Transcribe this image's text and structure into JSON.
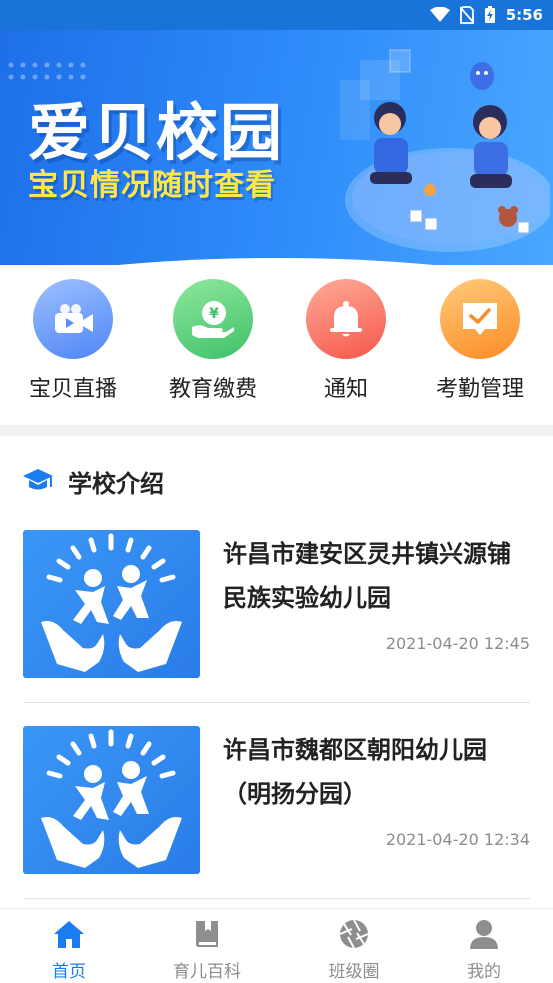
{
  "status_bar": {
    "time": "5:56"
  },
  "banner": {
    "title": "爱贝校园",
    "subtitle": "宝贝情况随时查看",
    "slide_count": 3,
    "active_slide": 1
  },
  "quick_entries": [
    {
      "label": "宝贝直播",
      "icon": "video-camera-icon",
      "color_from": "#8db2ff",
      "color_to": "#4e86f6"
    },
    {
      "label": "教育缴费",
      "icon": "yuan-hand-icon",
      "color_from": "#7ee08d",
      "color_to": "#3fc169"
    },
    {
      "label": "通知",
      "icon": "bell-icon",
      "color_from": "#ff9b87",
      "color_to": "#f5574b"
    },
    {
      "label": "考勤管理",
      "icon": "calendar-check-icon",
      "color_from": "#ffc06a",
      "color_to": "#fb8b25"
    }
  ],
  "school_intro": {
    "section_title": "学校介绍",
    "icon": "graduation-cap-icon",
    "items": [
      {
        "title": "许昌市建安区灵井镇兴源铺民族实验幼儿园",
        "time": "2021-04-20 12:45"
      },
      {
        "title": "许昌市魏都区朝阳幼儿园（明扬分园）",
        "time": "2021-04-20 12:34"
      }
    ]
  },
  "bottom_nav": {
    "items": [
      {
        "label": "首页",
        "icon": "home-icon",
        "active": true
      },
      {
        "label": "育儿百科",
        "icon": "book-icon",
        "active": false
      },
      {
        "label": "班级圈",
        "icon": "aperture-icon",
        "active": false
      },
      {
        "label": "我的",
        "icon": "user-icon",
        "active": false
      }
    ]
  },
  "colors": {
    "primary": "#1b7cf0",
    "banner_subtitle": "#ffe74a",
    "inactive_nav": "#8e8e8e"
  }
}
